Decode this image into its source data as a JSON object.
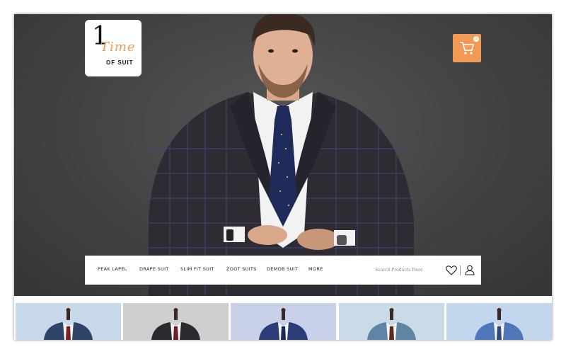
{
  "brand": {
    "logo_number": "1",
    "logo_word": "Time",
    "logo_sub": "OF SUIT"
  },
  "cart": {
    "count": "0"
  },
  "nav": {
    "items": [
      "PEAK LAPEL",
      "DRAPE SUIT",
      "SLIM FIT SUIT",
      "ZOOT SUITS",
      "DEMOB SUIT",
      "MORE"
    ],
    "search_placeholder": "Search Products Here"
  },
  "colors": {
    "accent": "#f19a56",
    "hero_bg": "#424242"
  },
  "icons": [
    "cart-icon",
    "heart-icon",
    "user-icon"
  ],
  "products": [
    {
      "bg": "#c8d9ea",
      "suit": "#2e4569",
      "tie": "#7a1f1f"
    },
    {
      "bg": "#cfcfcf",
      "suit": "#2a2a30",
      "tie": "#6b1f2b"
    },
    {
      "bg": "#c9d0ea",
      "suit": "#2b3d78",
      "tie": "#1d2a55"
    },
    {
      "bg": "#c9dbe6",
      "suit": "#5f84a6",
      "tie": "#5a2a1a"
    },
    {
      "bg": "#c4d5ee",
      "suit": "#4f76b8",
      "tie": "#2f4b7c"
    }
  ]
}
